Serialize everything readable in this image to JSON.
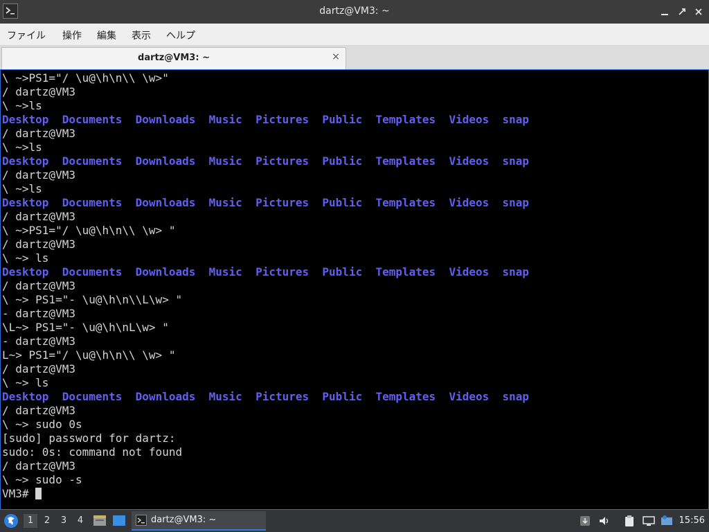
{
  "window": {
    "title": "dartz@VM3: ~"
  },
  "menu": [
    "ファイル",
    "操作",
    "編集",
    "表示",
    "ヘルプ"
  ],
  "tab": {
    "label": "dartz@VM3: ~",
    "close": "×"
  },
  "dirs": [
    "Desktop",
    "Documents",
    "Downloads",
    "Music",
    "Pictures",
    "Public",
    "Templates",
    "Videos",
    "snap"
  ],
  "terminal": {
    "lines": [
      "\\ ~>PS1=\"/ \\u@\\h\\n\\\\ \\w>\"",
      "/ dartz@VM3",
      "\\ ~>ls",
      "@DIRS",
      "/ dartz@VM3",
      "\\ ~>ls",
      "@DIRS",
      "/ dartz@VM3",
      "\\ ~>ls",
      "@DIRS",
      "/ dartz@VM3",
      "\\ ~>PS1=\"/ \\u@\\h\\n\\\\ \\w> \"",
      "/ dartz@VM3",
      "\\ ~> ls",
      "@DIRS",
      "/ dartz@VM3",
      "\\ ~> PS1=\"- \\u@\\h\\n\\\\L\\w> \"",
      "- dartz@VM3",
      "\\L~> PS1=\"- \\u@\\h\\nL\\w> \"",
      "- dartz@VM3",
      "L~> PS1=\"/ \\u@\\h\\n\\\\ \\w> \"",
      "/ dartz@VM3",
      "\\ ~> ls",
      "@DIRS",
      "/ dartz@VM3",
      "\\ ~> sudo 0s",
      "[sudo] password for dartz:",
      "sudo: 0s: command not found",
      "/ dartz@VM3",
      "\\ ~> sudo -s"
    ],
    "prompt": "VM3# "
  },
  "taskbar": {
    "workspaces": [
      "1",
      "2",
      "3",
      "4"
    ],
    "active_workspace": "1",
    "task_label": "dartz@VM3: ~",
    "clock": "15:56"
  },
  "colors": {
    "directory": "#6060f0",
    "text": "#d4d4d4",
    "accent": "#2f7fe0"
  }
}
